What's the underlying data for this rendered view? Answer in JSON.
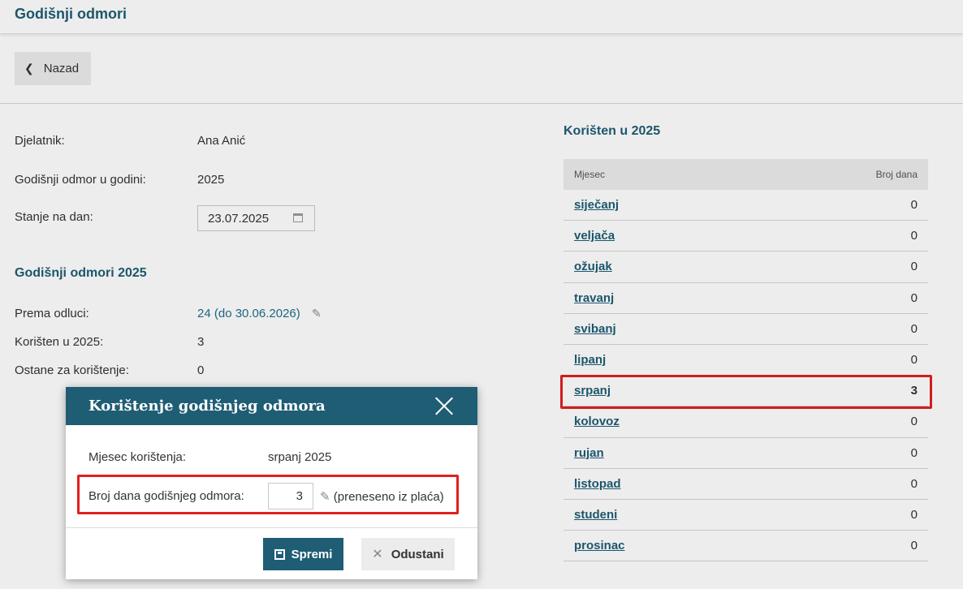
{
  "header": {
    "title": "Godišnji odmori"
  },
  "back_button": {
    "label": "Nazad"
  },
  "details": {
    "employee_label": "Djelatnik:",
    "employee_value": "Ana Anić",
    "year_label": "Godišnji odmor u godini:",
    "year_value": "2025",
    "balance_label": "Stanje na dan:",
    "balance_value": "23.07.2025"
  },
  "summary": {
    "title": "Godišnji odmori 2025",
    "decision_label": "Prema odluci:",
    "decision_value": "24 (do 30.06.2026)",
    "used_label": "Korišten u 2025:",
    "used_value": "3",
    "remaining_label": "Ostane za korištenje:",
    "remaining_value": "0"
  },
  "usage_table": {
    "title": "Korišten u 2025",
    "col_month": "Mjesec",
    "col_days": "Broj dana",
    "rows": [
      {
        "month": "siječanj",
        "days": "0"
      },
      {
        "month": "veljača",
        "days": "0"
      },
      {
        "month": "ožujak",
        "days": "0"
      },
      {
        "month": "travanj",
        "days": "0"
      },
      {
        "month": "svibanj",
        "days": "0"
      },
      {
        "month": "lipanj",
        "days": "0"
      },
      {
        "month": "srpanj",
        "days": "3"
      },
      {
        "month": "kolovoz",
        "days": "0"
      },
      {
        "month": "rujan",
        "days": "0"
      },
      {
        "month": "listopad",
        "days": "0"
      },
      {
        "month": "studeni",
        "days": "0"
      },
      {
        "month": "prosinac",
        "days": "0"
      }
    ]
  },
  "modal": {
    "title": "Korištenje godišnjeg odmora",
    "month_label": "Mjesec korištenja:",
    "month_value": "srpanj 2025",
    "days_label": "Broj dana godišnjeg odmora:",
    "days_value": "3",
    "days_note": "(preneseno iz plaća)",
    "save_label": "Spremi",
    "cancel_label": "Odustani"
  },
  "colors": {
    "brand": "#1e5d74",
    "highlight": "#e02020"
  }
}
